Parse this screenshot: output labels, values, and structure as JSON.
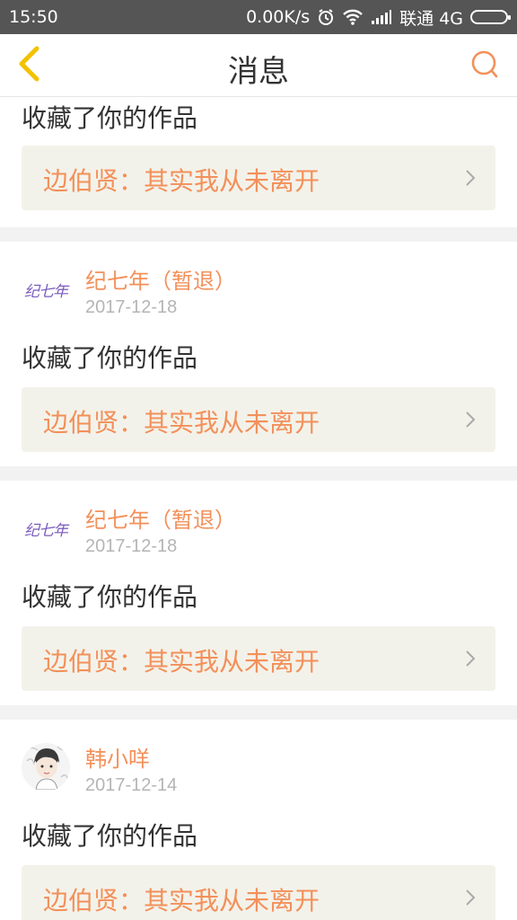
{
  "status_bar": {
    "time": "15:50",
    "network_speed": "0.00K/s",
    "carrier": "联通 4G",
    "icons": [
      "alarm-icon",
      "wifi-icon",
      "signal-icon",
      "battery-icon"
    ]
  },
  "header": {
    "title": "消息",
    "back_icon": "chevron-left-icon",
    "search_icon": "search-icon"
  },
  "colors": {
    "accent": "#f3905a",
    "back_icon": "#f2c200",
    "status_bar_bg": "#555555",
    "work_box_bg": "#f3f2ea",
    "section_gap": "#f2f2f2"
  },
  "messages": [
    {
      "action": "收藏了你的作品",
      "work": "边伯贤：其实我从未离开"
    },
    {
      "user": "纪七年（暂退）",
      "avatar_text": "纪七年",
      "date": "2017-12-18",
      "action": "收藏了你的作品",
      "work": "边伯贤：其实我从未离开"
    },
    {
      "user": "纪七年（暂退）",
      "avatar_text": "纪七年",
      "date": "2017-12-18",
      "action": "收藏了你的作品",
      "work": "边伯贤：其实我从未离开"
    },
    {
      "user": "韩小咩",
      "date": "2017-12-14",
      "action": "收藏了你的作品",
      "work": "边伯贤：其实我从未离开"
    }
  ]
}
